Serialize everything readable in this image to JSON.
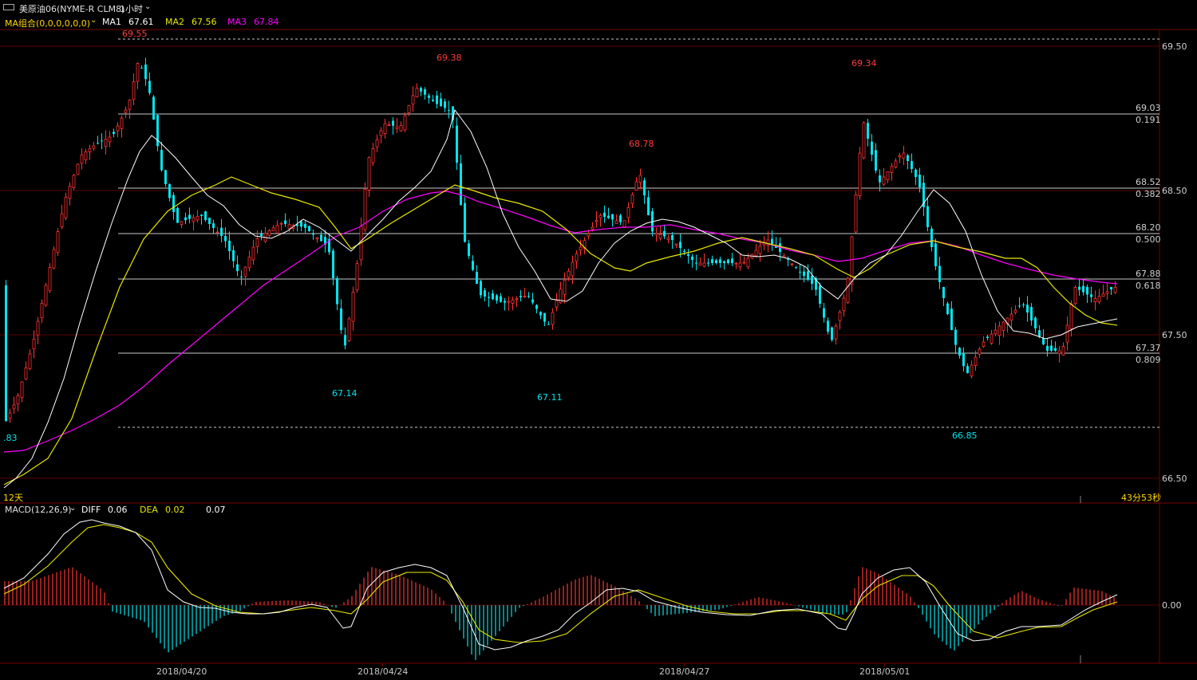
{
  "header": {
    "icon": "window-toggle-icon",
    "symbol": "美原油06(NYME-R CLM8)",
    "period": "1小时",
    "period_arrow": "chevron-down-icon"
  },
  "ma_bar": {
    "combo_label": "MA组合(0,0,0,0,0,0)",
    "ma1_label": "MA1",
    "ma1_value": "67.61",
    "ma2_label": "MA2",
    "ma2_value": "67.56",
    "ma3_label": "MA3",
    "ma3_value": "67.84",
    "colors": {
      "ma1": "#ffffff",
      "ma2": "#e8e800",
      "ma3": "#ff00ff"
    }
  },
  "price_axis": [
    "69.50",
    "68.50",
    "67.50",
    "66.50"
  ],
  "fib_levels": [
    {
      "price": "69.03",
      "ratio": "0.191"
    },
    {
      "price": "68.52",
      "ratio": "0.382"
    },
    {
      "price": "68.20",
      "ratio": "0.500"
    },
    {
      "price": "67.88",
      "ratio": "0.618"
    },
    {
      "price": "67.37",
      "ratio": "0.809"
    }
  ],
  "annotations": {
    "high1": "69.55",
    "high2": "69.38",
    "high3": "68.78",
    "high4": "69.34",
    "low1": "67.14",
    "low2": "67.11",
    "low3": "66.85",
    "left_cut": ".83"
  },
  "status": {
    "left": "12天",
    "right": "43分53秒"
  },
  "macd_bar": {
    "label": "MACD(12,26,9)",
    "diff_label": "DIFF",
    "diff_value": "0.06",
    "dea_label": "DEA",
    "dea_value": "0.02",
    "macd_value": "0.07"
  },
  "macd_axis": [
    "0.00"
  ],
  "x_axis": [
    "2018/04/20",
    "2018/04/24",
    "2018/04/27",
    "2018/05/01"
  ],
  "colors": {
    "up": "#ff3232",
    "down": "#00e5ee",
    "grid_red": "#7a0000",
    "fib": "#c8c8c8"
  }
}
